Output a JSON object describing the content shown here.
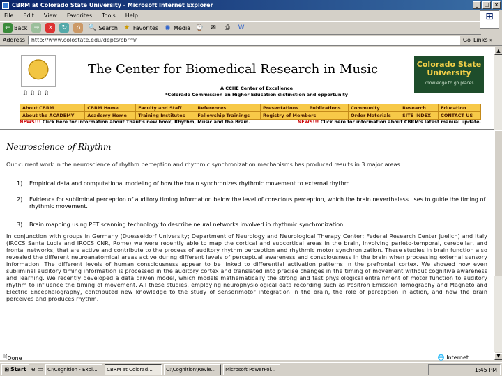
{
  "window": {
    "title": "CBRM at Colorado State University - Microsoft Internet Explorer",
    "min": "_",
    "max": "□",
    "close": "×"
  },
  "menu": [
    "File",
    "Edit",
    "View",
    "Favorites",
    "Tools",
    "Help"
  ],
  "toolbar": {
    "back": "Back",
    "search": "Search",
    "favorites": "Favorites",
    "media": "Media"
  },
  "address": {
    "label": "Address",
    "value": "http://www.colostate.edu/depts/cbrm/",
    "go": "Go",
    "links": "Links »"
  },
  "page": {
    "title": "The Center for Biomedical Research in Music",
    "excellence_line1": "A CCHE Center of Excellence",
    "excellence_line2": "*Colorado Commission on Higher Education distinction and opportunity",
    "csu_name": "Colorado State University",
    "csu_tag": "knowledge to go places",
    "nav_row1": [
      "About CBRM",
      "CBRM Home",
      "Faculty and Staff",
      "References",
      "Presentations",
      "Publications",
      "Community",
      "Research",
      "Education"
    ],
    "nav_row2": [
      "About the ACADEMY",
      "Academy Home",
      "Training Institutes",
      "Fellowship Trainings",
      "Registry of Members",
      "Order Materials",
      "SITE INDEX",
      "CONTACT US"
    ],
    "news_left_tag": "NEWS!!!",
    "news_left": "Click here for information about Thaut's new book, Rhythm, Music and the Brain.",
    "news_right_tag": "NEWS!!!",
    "news_right": "Click here for information about CBRM's latest manual update.",
    "heading": "Neuroscience of Rhythm",
    "intro": "Our current work in the neuroscience of rhythm perception and rhythmic synchronization mechanisms has produced results in 3 major areas:",
    "items": [
      {
        "n": "1)",
        "text": "Empirical data and computational modeling of how the brain synchronizes rhythmic movement to external rhythm."
      },
      {
        "n": "2)",
        "text": "Evidence for subliminal perception of auditory timing information below the level of conscious perception, which the brain nevertheless uses to guide the timing of rhythmic movement."
      },
      {
        "n": "3)",
        "text": "Brain mapping using PET scanning technology to describe neural networks involved in rhythmic synchronization."
      }
    ],
    "paragraph": "In conjunction with groups in Germany (Duesseldorf University; Department of Neurology and Neurological Therapy Center; Federal Research Center Juelich) and Italy (IRCCS Santa Lucia and IRCCS CNR, Rome) we were recently able to map the cortical and subcortical areas in the brain, involving parieto-temporal, cerebellar, and frontal networks, that are active and contribute to the process of auditory rhythm perception and rhythmic motor synchronization. These studies in brain function also revealed the different neuroanatomical areas active during different levels of perceptual awareness and consciousness in the brain when processing external sensory information. The different levels of human consciousness appear to be linked to differential activation patterns in the prefrontal cortex. We showed how even subliminal auditory timing information is processed in the auditory cortex and translated into precise changes in the timing of movement without cognitive awareness and learning. We recently developed a data driven model, which models mathematically the strong and fast physiological entrainment of motor function to auditory rhythm to influence the timing of movement. All these studies, employing neurophysiological data recording such as Positron Emission Tomography and Magneto and Electric Encephalography, contributed new knowledge to the study of sensorimotor integration in the brain, the role of perception in action, and how the brain perceives and produces rhythm."
  },
  "status": {
    "left": "Done",
    "zone": "Internet"
  },
  "taskbar": {
    "start": "Start",
    "tasks": [
      "C:\\Cognition - Expl...",
      "CBRM at Colorad...",
      "C:\\Cognition\\Revie...",
      "Microsoft PowerPoi..."
    ],
    "active": 1,
    "clock": "1:45 PM"
  }
}
